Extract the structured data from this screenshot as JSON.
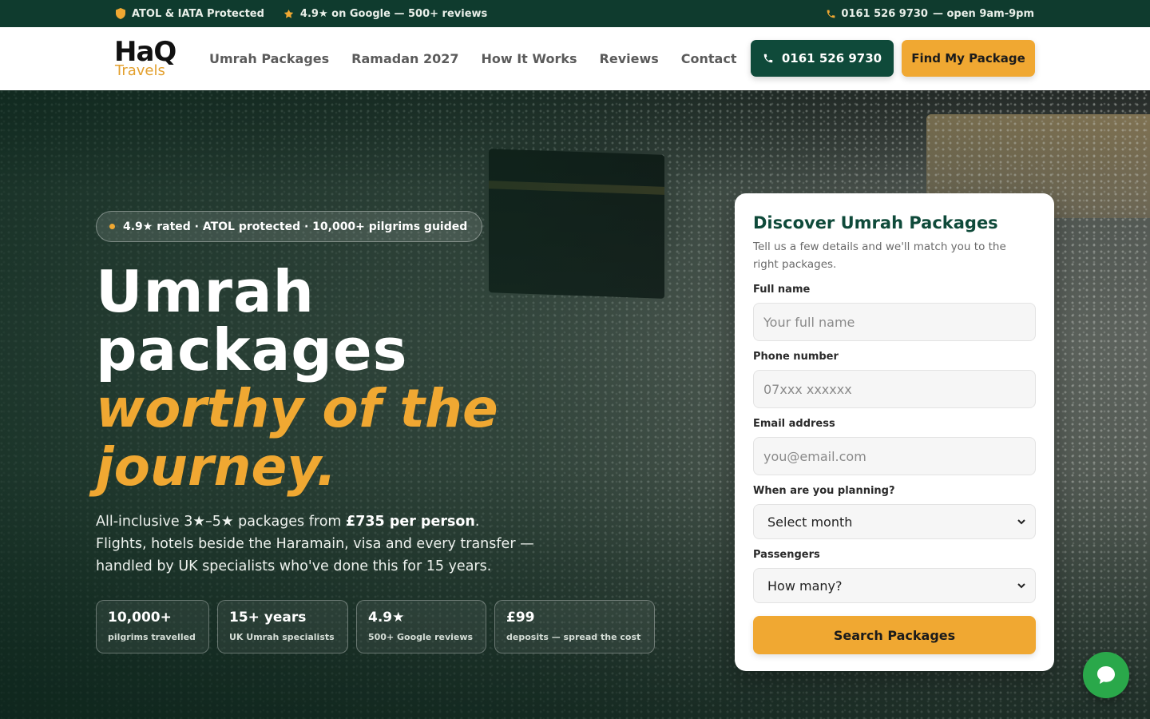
{
  "topbar": {
    "atol": "ATOL & IATA Protected",
    "google": "4.9★ on Google — 500+ reviews",
    "phone": "0161 526 9730",
    "hours": "— open 9am-9pm"
  },
  "brand": {
    "line1": "HaQ",
    "line2": "Travels"
  },
  "nav": [
    {
      "label": "Umrah Packages"
    },
    {
      "label": "Ramadan 2027"
    },
    {
      "label": "How It Works"
    },
    {
      "label": "Reviews"
    },
    {
      "label": "Contact"
    }
  ],
  "header": {
    "phone_button": "0161 526 9730",
    "find_button": "Find My Package"
  },
  "hero": {
    "pill": "4.9★ rated · ATOL protected · 10,000+ pilgrims guided",
    "title_white_1": "Umrah",
    "title_white_2": "packages",
    "title_gold_1": "worthy of the",
    "title_gold_2": "journey.",
    "lead_1": "All-inclusive 3★–5★ packages from ",
    "lead_bold": "£735 per person",
    "lead_2": ".",
    "lead_3": "Flights, hotels beside the Haramain, visa and every transfer — handled by UK specialists who've done this for 15 years."
  },
  "stats": [
    {
      "value": "10,000+",
      "label": "pilgrims travelled"
    },
    {
      "value": "15+ years",
      "label": "UK Umrah specialists"
    },
    {
      "value": "4.9★",
      "label": "500+ Google reviews"
    },
    {
      "value": "£99",
      "label": "deposits — spread the cost"
    }
  ],
  "form": {
    "title": "Discover Umrah Packages",
    "subtitle": "Tell us a few details and we'll match you to the right packages.",
    "name_label": "Full name",
    "name_placeholder": "Your full name",
    "phone_label": "Phone number",
    "phone_placeholder": "07xxx xxxxxx",
    "email_label": "Email address",
    "email_placeholder": "you@email.com",
    "when_label": "When are you planning?",
    "when_value": "Select month",
    "pax_label": "Passengers",
    "pax_value": "How many?",
    "submit": "Search Packages"
  },
  "colors": {
    "brand_green": "#0f4a3a",
    "accent_gold": "#f0a832",
    "topbar": "#0f3b2e",
    "chat_green": "#2aa84a"
  },
  "icons": [
    "shield-icon",
    "star-icon",
    "phone-icon",
    "chevron-down-icon",
    "chat-bubble-icon"
  ]
}
